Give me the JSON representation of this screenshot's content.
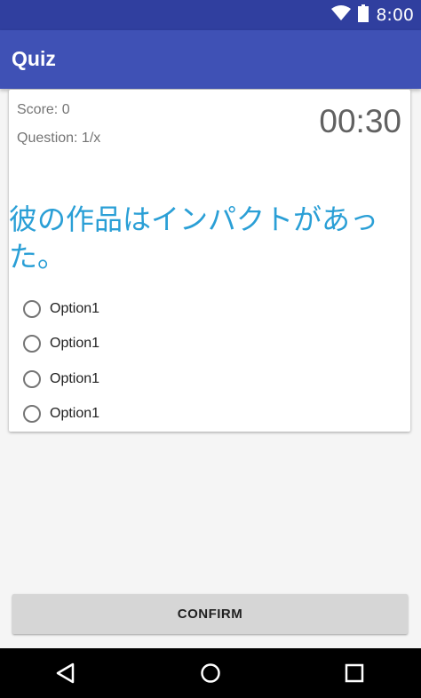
{
  "status_bar": {
    "time": "8:00",
    "icons": [
      "wifi-icon",
      "battery-icon"
    ],
    "color": "#303F9F"
  },
  "app_bar": {
    "title": "Quiz",
    "color": "#3F51B5"
  },
  "quiz": {
    "score": "Score: 0",
    "question_count": "Question: 1/x",
    "timer": "00:30",
    "question": "彼の作品はインパクトがあった。",
    "question_color": "#2a9fd6",
    "options": [
      {
        "label": "Option1",
        "selected": false
      },
      {
        "label": "Option1",
        "selected": false
      },
      {
        "label": "Option1",
        "selected": false
      },
      {
        "label": "Option1",
        "selected": false
      }
    ]
  },
  "actions": {
    "confirm_label": "CONFIRM"
  },
  "nav_bar": {
    "buttons": [
      "back-icon",
      "home-icon",
      "recents-icon"
    ]
  }
}
